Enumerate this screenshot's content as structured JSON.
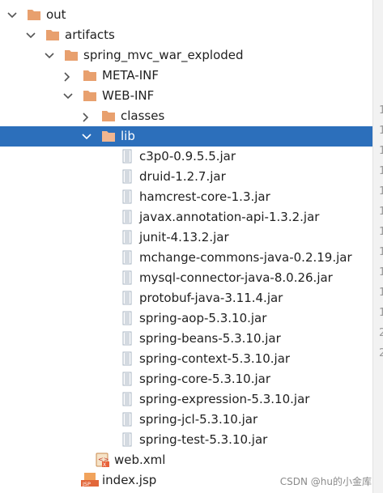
{
  "tree": [
    {
      "label": "out",
      "type": "folder",
      "expanded": true,
      "depth": 0
    },
    {
      "label": "artifacts",
      "type": "folder",
      "expanded": true,
      "depth": 1
    },
    {
      "label": "spring_mvc_war_exploded",
      "type": "folder",
      "expanded": true,
      "depth": 2
    },
    {
      "label": "META-INF",
      "type": "folder",
      "expanded": false,
      "depth": 3
    },
    {
      "label": "WEB-INF",
      "type": "folder",
      "expanded": true,
      "depth": 3
    },
    {
      "label": "classes",
      "type": "folder",
      "expanded": false,
      "depth": 4
    },
    {
      "label": "lib",
      "type": "folder",
      "expanded": true,
      "depth": 4,
      "selected": true
    },
    {
      "label": "c3p0-0.9.5.5.jar",
      "type": "jar",
      "depth": 5
    },
    {
      "label": "druid-1.2.7.jar",
      "type": "jar",
      "depth": 5
    },
    {
      "label": "hamcrest-core-1.3.jar",
      "type": "jar",
      "depth": 5
    },
    {
      "label": "javax.annotation-api-1.3.2.jar",
      "type": "jar",
      "depth": 5
    },
    {
      "label": "junit-4.13.2.jar",
      "type": "jar",
      "depth": 5
    },
    {
      "label": "mchange-commons-java-0.2.19.jar",
      "type": "jar",
      "depth": 5
    },
    {
      "label": "mysql-connector-java-8.0.26.jar",
      "type": "jar",
      "depth": 5
    },
    {
      "label": "protobuf-java-3.11.4.jar",
      "type": "jar",
      "depth": 5
    },
    {
      "label": "spring-aop-5.3.10.jar",
      "type": "jar",
      "depth": 5
    },
    {
      "label": "spring-beans-5.3.10.jar",
      "type": "jar",
      "depth": 5
    },
    {
      "label": "spring-context-5.3.10.jar",
      "type": "jar",
      "depth": 5
    },
    {
      "label": "spring-core-5.3.10.jar",
      "type": "jar",
      "depth": 5
    },
    {
      "label": "spring-expression-5.3.10.jar",
      "type": "jar",
      "depth": 5
    },
    {
      "label": "spring-jcl-5.3.10.jar",
      "type": "jar",
      "depth": 5
    },
    {
      "label": "spring-test-5.3.10.jar",
      "type": "jar",
      "depth": 5
    },
    {
      "label": "web.xml",
      "type": "xml",
      "depth": 4
    },
    {
      "label": "index.jsp",
      "type": "jsp",
      "depth": 3
    }
  ],
  "gutter_numbers": [
    "1",
    "1",
    "1",
    "1",
    "1",
    "1",
    "1",
    "1",
    "1",
    "1",
    "1",
    "2",
    "2"
  ],
  "watermark": "CSDN @hu的小金库",
  "colors": {
    "folder": "#e8a06e",
    "folder_selected": "#f1b690",
    "selection": "#2c6fbb",
    "jar": "#a9b6c3"
  }
}
